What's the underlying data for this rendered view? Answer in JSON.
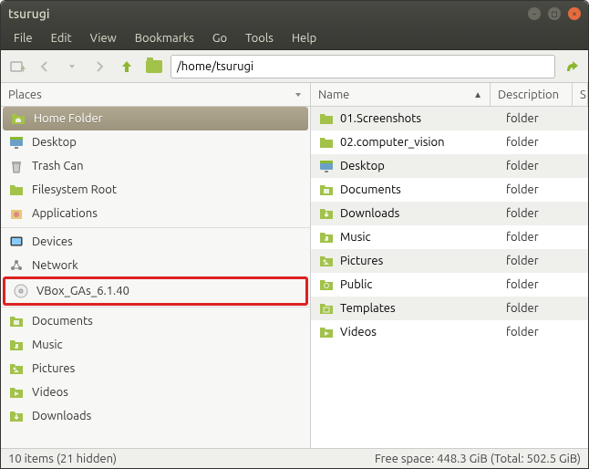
{
  "window": {
    "title": "tsurugi"
  },
  "menu": [
    "File",
    "Edit",
    "View",
    "Bookmarks",
    "Go",
    "Tools",
    "Help"
  ],
  "location": {
    "path": "/home/tsurugi"
  },
  "sidebar": {
    "header": "Places",
    "items": [
      {
        "label": "Home Folder",
        "icon": "folder-home",
        "selected": true
      },
      {
        "label": "Desktop",
        "icon": "desktop"
      },
      {
        "label": "Trash Can",
        "icon": "trash"
      },
      {
        "label": "Filesystem Root",
        "icon": "folder"
      },
      {
        "label": "Applications",
        "icon": "apps"
      },
      {
        "label": "Devices",
        "icon": "device",
        "divider_before": true
      },
      {
        "label": "Network",
        "icon": "network"
      },
      {
        "label": "VBox_GAs_6.1.40",
        "icon": "disc",
        "highlighted": true
      },
      {
        "label": "Documents",
        "icon": "folder-doc",
        "divider_before": true
      },
      {
        "label": "Music",
        "icon": "folder-music"
      },
      {
        "label": "Pictures",
        "icon": "folder-pic"
      },
      {
        "label": "Videos",
        "icon": "folder-vid"
      },
      {
        "label": "Downloads",
        "icon": "folder-dl"
      }
    ]
  },
  "files": {
    "columns": {
      "name": "Name",
      "description": "Description",
      "last": "S"
    },
    "rows": [
      {
        "name": "01.Screenshots",
        "desc": "folder",
        "icon": "folder"
      },
      {
        "name": "02.computer_vision",
        "desc": "folder",
        "icon": "folder"
      },
      {
        "name": "Desktop",
        "desc": "folder",
        "icon": "desktop"
      },
      {
        "name": "Documents",
        "desc": "folder",
        "icon": "folder-doc"
      },
      {
        "name": "Downloads",
        "desc": "folder",
        "icon": "folder-dl"
      },
      {
        "name": "Music",
        "desc": "folder",
        "icon": "folder-music"
      },
      {
        "name": "Pictures",
        "desc": "folder",
        "icon": "folder-pic"
      },
      {
        "name": "Public",
        "desc": "folder",
        "icon": "folder-pub"
      },
      {
        "name": "Templates",
        "desc": "folder",
        "icon": "folder-tpl"
      },
      {
        "name": "Videos",
        "desc": "folder",
        "icon": "folder-vid"
      }
    ]
  },
  "status": {
    "left": "10 items (21 hidden)",
    "right": "Free space: 448.3 GiB (Total: 502.5 GiB)"
  }
}
